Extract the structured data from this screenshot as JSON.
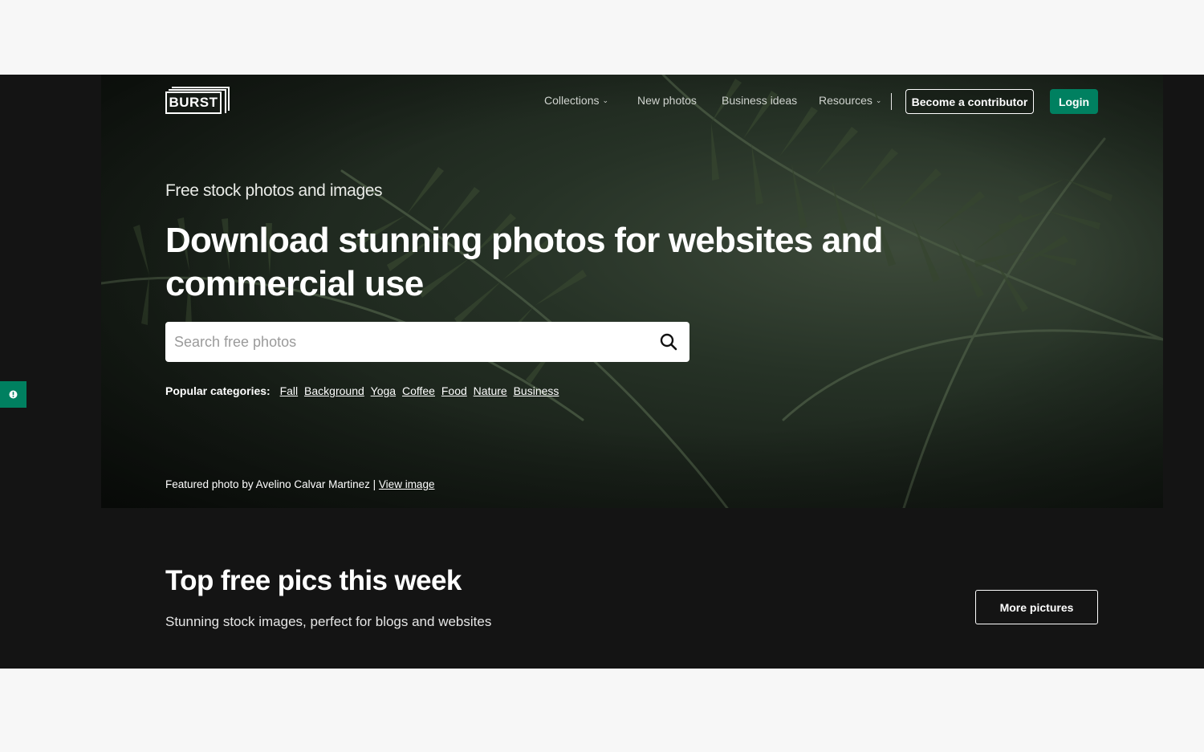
{
  "brand": {
    "logo_text": "BURST"
  },
  "nav": {
    "items": [
      {
        "label": "Collections",
        "has_dropdown": true
      },
      {
        "label": "New photos",
        "has_dropdown": false
      },
      {
        "label": "Business ideas",
        "has_dropdown": false
      },
      {
        "label": "Resources",
        "has_dropdown": true
      }
    ],
    "contributor_label": "Become a contributor",
    "login_label": "Login"
  },
  "hero": {
    "kicker": "Free stock photos and images",
    "headline": "Download stunning photos for websites and commercial use",
    "search": {
      "placeholder": "Search free photos",
      "value": ""
    },
    "popular_label": "Popular categories:",
    "categories": [
      "Fall",
      "Background",
      "Yoga",
      "Coffee",
      "Food",
      "Nature",
      "Business"
    ],
    "featured_prefix": "Featured photo by Avelino Calvar Martinez |",
    "featured_link": "View image"
  },
  "section": {
    "title": "Top free pics this week",
    "subtitle": "Stunning stock images, perfect for blogs and websites",
    "more_label": "More pictures"
  },
  "colors": {
    "brand_green": "#008060",
    "dark_band": "#141414",
    "page_bg": "#f7f7f7"
  },
  "icons": {
    "search": "search-icon",
    "chevron": "chevron-down-icon",
    "side_tab": "info-icon"
  }
}
